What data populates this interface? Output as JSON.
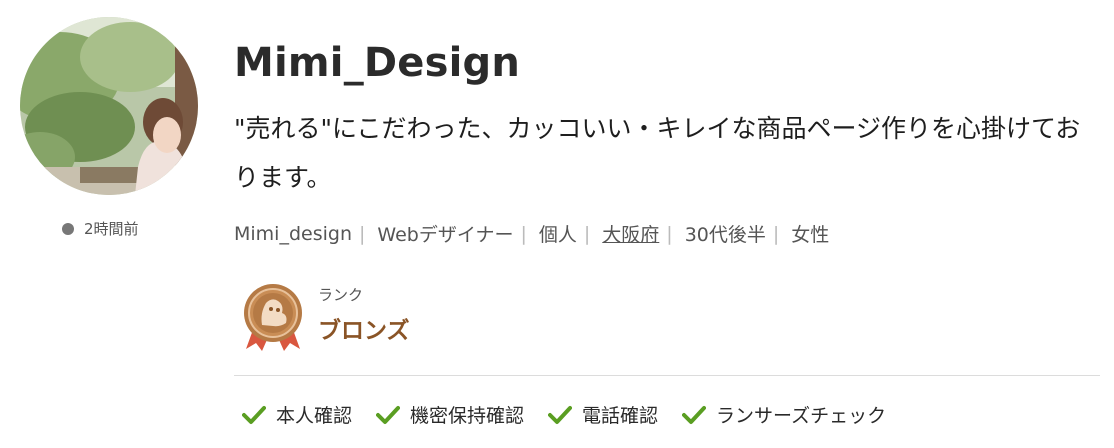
{
  "profile": {
    "name": "Mimi_Design",
    "bio": "\"売れる\"にこだわった、カッコいい・キレイな商品ページ作りを心掛けております。",
    "last_active": "2時間前",
    "meta": [
      "Mimi_design",
      "Webデザイナー",
      "個人",
      "大阪府",
      "30代後半",
      "女性"
    ]
  },
  "rank": {
    "label": "ランク",
    "value": "ブロンズ",
    "color": "#8a5426"
  },
  "verifications": [
    "本人確認",
    "機密保持確認",
    "電話確認",
    "ランサーズチェック"
  ],
  "colors": {
    "check": "#5a9e22",
    "badge": "#b57a45",
    "ribbon": "#d9573f"
  },
  "icons": {
    "avatar": "profile-photo-garden",
    "badge": "bronze-rank-medal-icon",
    "check": "check-icon"
  }
}
